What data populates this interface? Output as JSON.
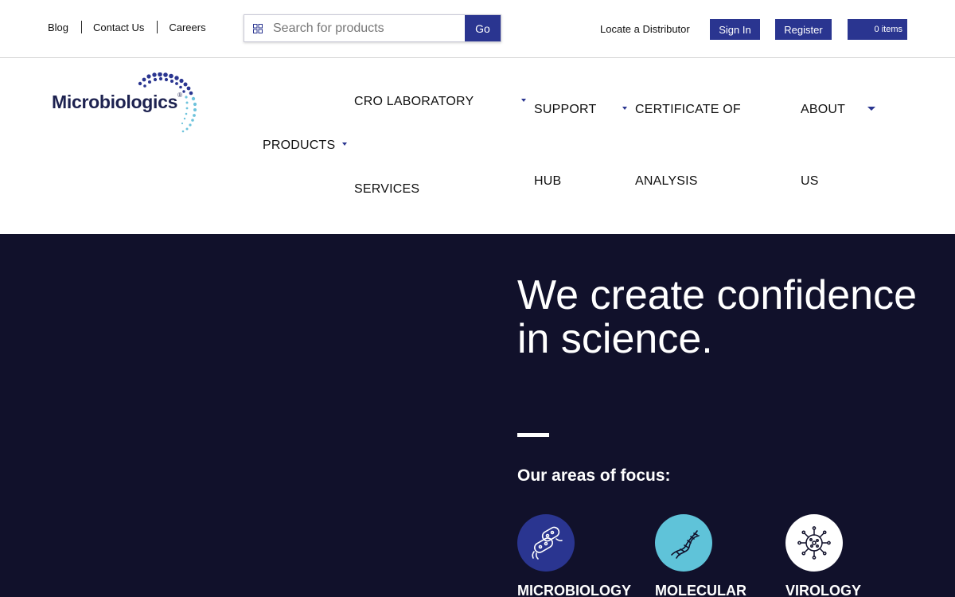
{
  "utility": {
    "links": [
      "Blog",
      "Contact Us",
      "Careers"
    ]
  },
  "search": {
    "placeholder": "Search for products",
    "value": "",
    "go_label": "Go",
    "icon": "grid-search-icon"
  },
  "account": {
    "locate_label": "Locate a Distributor",
    "signin_label": "Sign In",
    "register_label": "Register",
    "cart_label": "0 items"
  },
  "brand": {
    "logo_text": "Microbiologics",
    "registered_mark": "®"
  },
  "nav": {
    "products": "PRODUCTS",
    "cro_line1": "CRO LABORATORY",
    "cro_line2": "SERVICES",
    "support_line1": "SUPPORT",
    "support_line2": "HUB",
    "coa_line1": "CERTIFICATE OF",
    "coa_line2": "ANALYSIS",
    "about_line1": "ABOUT",
    "about_line2": "US"
  },
  "hero": {
    "title": "We create confidence in science.",
    "focus_heading": "Our areas of focus:",
    "focus_areas": [
      {
        "label": "MICROBIOLOGY",
        "icon": "bacteria-icon",
        "color": "#2a3590"
      },
      {
        "label": "MOLECULAR",
        "icon": "dna-icon",
        "color": "#5fc3d9"
      },
      {
        "label": "VIROLOGY",
        "icon": "virus-icon",
        "color": "#ffffff"
      }
    ]
  },
  "colors": {
    "brand_blue": "#2a3590",
    "hero_bg": "#11112b",
    "molecular_teal": "#5fc3d9"
  }
}
